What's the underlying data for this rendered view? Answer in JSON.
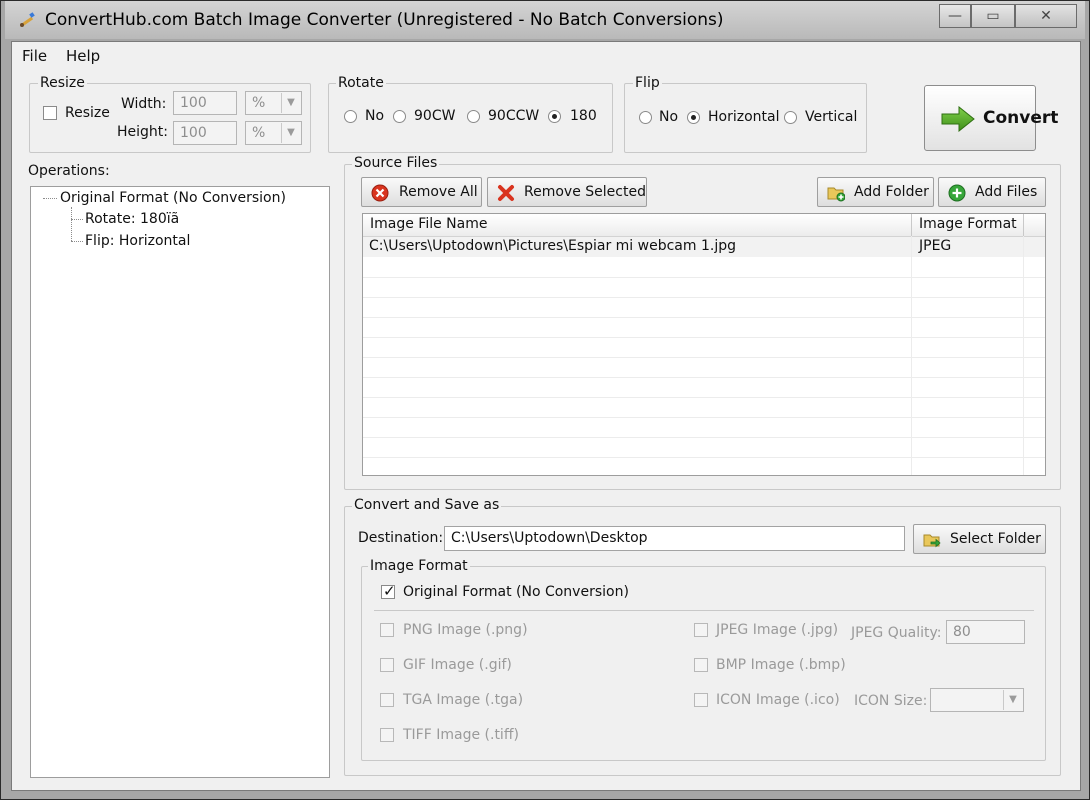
{
  "window": {
    "title": "ConvertHub.com Batch Image Converter (Unregistered - No Batch Conversions)",
    "minimize_glyph": "—",
    "maximize_glyph": "▭",
    "close_glyph": "✕"
  },
  "menu": {
    "items": [
      "File",
      "Help"
    ]
  },
  "resize": {
    "legend": "Resize",
    "checkbox_label": "Resize",
    "checked": false,
    "width_label": "Width:",
    "width_value": "100",
    "width_unit": "%",
    "height_label": "Height:",
    "height_value": "100",
    "height_unit": "%"
  },
  "rotate": {
    "legend": "Rotate",
    "options": [
      "No",
      "90CW",
      "90CCW",
      "180"
    ],
    "selected": "180"
  },
  "flip": {
    "legend": "Flip",
    "options": [
      "No",
      "Horizontal",
      "Vertical"
    ],
    "selected": "Horizontal"
  },
  "convert_button": {
    "label": "Convert",
    "icon": "green-arrow-right-icon"
  },
  "operations": {
    "label": "Operations:",
    "root": "Original Format (No Conversion)",
    "children": [
      "Rotate: 180ïã",
      "Flip: Horizontal"
    ]
  },
  "source_files": {
    "legend": "Source Files",
    "remove_all": "Remove All",
    "remove_selected": "Remove Selected",
    "add_folder": "Add Folder",
    "add_files": "Add Files",
    "columns": [
      "Image File Name",
      "Image Format"
    ],
    "rows": [
      {
        "name": "C:\\Users\\Uptodown\\Pictures\\Espiar mi webcam 1.jpg",
        "format": "JPEG"
      }
    ]
  },
  "save": {
    "legend": "Convert and Save as",
    "destination_label": "Destination:",
    "destination_value": "C:\\Users\\Uptodown\\Desktop",
    "select_folder": "Select Folder"
  },
  "image_format": {
    "legend": "Image Format",
    "original": {
      "label": "Original Format (No Conversion)",
      "checked": true
    },
    "png": "PNG Image (.png)",
    "gif": "GIF Image (.gif)",
    "tga": "TGA Image (.tga)",
    "tiff": "TIFF Image (.tiff)",
    "jpeg": "JPEG Image (.jpg)",
    "bmp": "BMP Image (.bmp)",
    "ico": "ICON Image (.ico)",
    "jpeg_quality_label": "JPEG Quality:",
    "jpeg_quality_value": "80",
    "icon_size_label": "ICON Size:",
    "icon_size_value": ""
  },
  "colors": {
    "accent_green": "#4a9a1e",
    "remove_red": "#d9341f",
    "add_green": "#37a63a",
    "folder_yellow": "#e9c75a"
  }
}
